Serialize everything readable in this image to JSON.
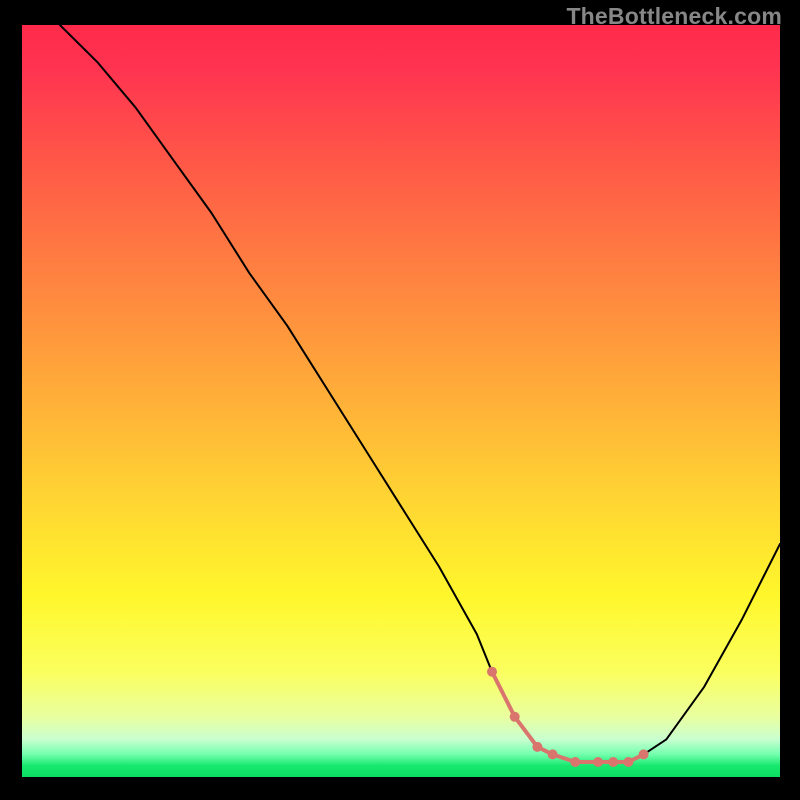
{
  "watermark": "TheBottleneck.com",
  "colors": {
    "background": "#000000",
    "curve": "#000000",
    "marker_fill": "#d9756d",
    "gradient_top": "#ff2a4a",
    "gradient_bottom": "#0bdc62"
  },
  "chart_data": {
    "type": "line",
    "title": "",
    "xlabel": "",
    "ylabel": "",
    "xlim": [
      0,
      100
    ],
    "ylim": [
      0,
      100
    ],
    "x": [
      5,
      10,
      15,
      20,
      25,
      30,
      35,
      40,
      45,
      50,
      55,
      60,
      62,
      65,
      68,
      70,
      73,
      76,
      78,
      80,
      82,
      85,
      90,
      95,
      100
    ],
    "values": [
      100,
      95,
      89,
      82,
      75,
      67,
      60,
      52,
      44,
      36,
      28,
      19,
      14,
      8,
      4,
      3,
      2,
      2,
      2,
      2,
      3,
      5,
      12,
      21,
      31
    ],
    "marked_region_x": [
      62,
      82
    ],
    "note": "x/y in percent of plot area; curve is bottleneck %, dips to ~0 near x≈72-78, red dots mark the low-bottleneck band"
  }
}
